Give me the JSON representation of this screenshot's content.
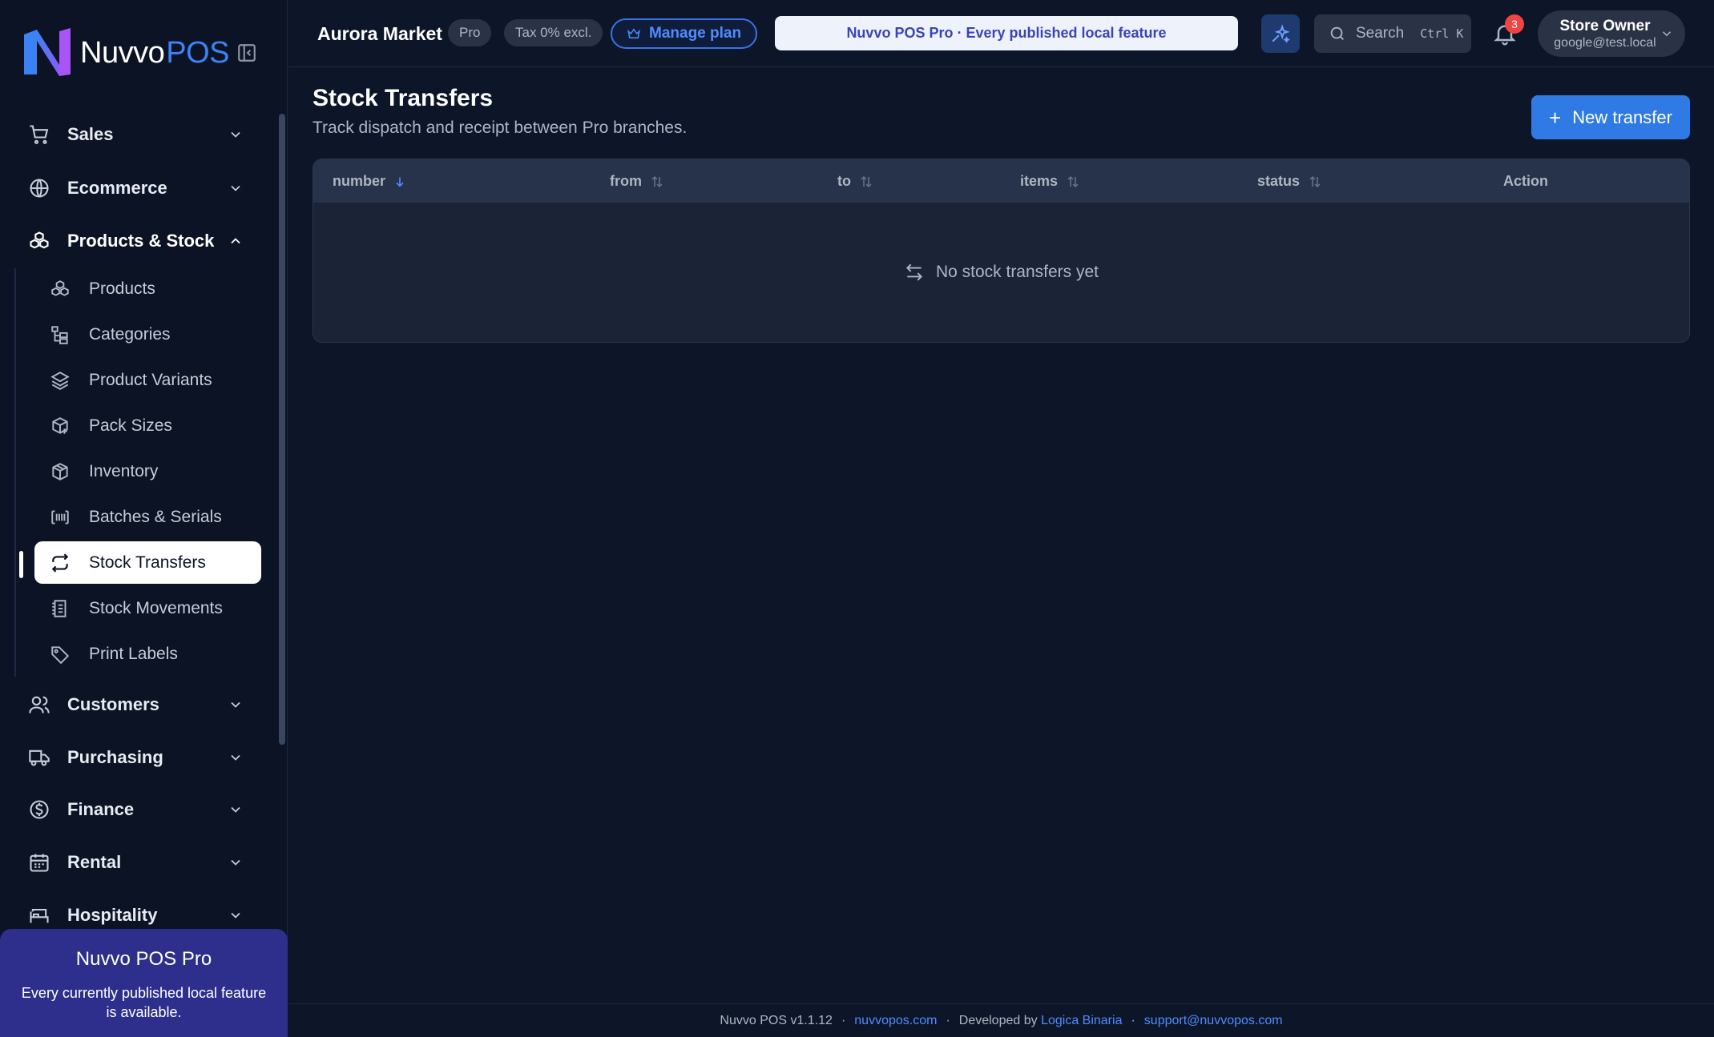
{
  "brand": {
    "name_part1": "Nuvvo",
    "name_part2": "POS"
  },
  "sidebar": {
    "groups_top": [
      {
        "label": "Sales",
        "icon": "cart-icon"
      },
      {
        "label": "Ecommerce",
        "icon": "globe-icon"
      },
      {
        "label": "Products & Stock",
        "icon": "boxes-icon",
        "expanded": true
      }
    ],
    "sub_items": [
      {
        "label": "Products",
        "icon": "boxes-icon"
      },
      {
        "label": "Categories",
        "icon": "hierarchy-icon"
      },
      {
        "label": "Product Variants",
        "icon": "layers-icon"
      },
      {
        "label": "Pack Sizes",
        "icon": "package-plus-icon"
      },
      {
        "label": "Inventory",
        "icon": "package-icon"
      },
      {
        "label": "Batches & Serials",
        "icon": "barcode-icon"
      },
      {
        "label": "Stock Transfers",
        "icon": "repeat-icon",
        "active": true
      },
      {
        "label": "Stock Movements",
        "icon": "ledger-icon"
      },
      {
        "label": "Print Labels",
        "icon": "tag-icon"
      }
    ],
    "groups_bottom": [
      {
        "label": "Customers",
        "icon": "users-icon"
      },
      {
        "label": "Purchasing",
        "icon": "truck-icon"
      },
      {
        "label": "Finance",
        "icon": "dollar-icon"
      },
      {
        "label": "Rental",
        "icon": "calendar-icon"
      },
      {
        "label": "Hospitality",
        "icon": "bed-icon"
      }
    ],
    "promo": {
      "title": "Nuvvo POS Pro",
      "description": "Every currently published local feature is available."
    }
  },
  "topbar": {
    "store_name": "Aurora Market",
    "plan_badge": "Pro",
    "tax_badge": "Tax 0% excl.",
    "manage_plan_label": "Manage plan",
    "banner_text": "Nuvvo POS Pro · Every published local feature",
    "search_label": "Search",
    "search_shortcut": "Ctrl K",
    "notification_count": "3",
    "user_name": "Store Owner",
    "user_email": "google@test.local"
  },
  "main": {
    "title": "Stock Transfers",
    "subtitle": "Track dispatch and receipt between Pro branches.",
    "new_button_label": "New transfer",
    "table": {
      "columns": [
        {
          "label": "number",
          "sort": "desc-active"
        },
        {
          "label": "from",
          "sort": "none"
        },
        {
          "label": "to",
          "sort": "none"
        },
        {
          "label": "items",
          "sort": "none"
        },
        {
          "label": "status",
          "sort": "none"
        },
        {
          "label": "Action",
          "sort": ""
        }
      ],
      "empty_text": "No stock transfers yet"
    }
  },
  "footer": {
    "version": "Nuvvo POS v1.1.12",
    "site_link": "nuvvopos.com",
    "developed_by_prefix": "Developed by",
    "developer_link": "Logica Binaria",
    "support_link": "support@nuvvopos.com",
    "separator": "·"
  },
  "colors": {
    "background": "#0d1628",
    "sidebar_bg": "#0b1324",
    "accent": "#2f7ae5",
    "promo_bg": "#2e2f8c",
    "badge_red": "#ef4444"
  }
}
